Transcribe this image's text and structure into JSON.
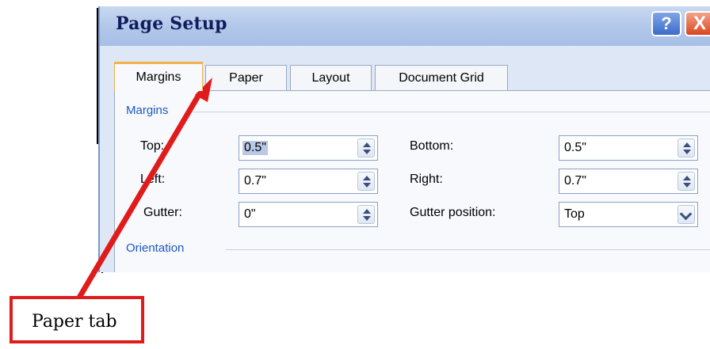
{
  "dialog": {
    "title": "Page Setup",
    "help_label": "?",
    "close_label": "X",
    "tabs": [
      {
        "label": "Margins"
      },
      {
        "label": "Paper"
      },
      {
        "label": "Layout"
      },
      {
        "label": "Document Grid"
      }
    ],
    "margins_group": "Margins",
    "fields": {
      "top": {
        "label": "Top:",
        "value": "0.5\""
      },
      "bottom": {
        "label": "Bottom:",
        "value": "0.5\""
      },
      "left": {
        "label": "Left:",
        "value": "0.7\""
      },
      "right": {
        "label": "Right:",
        "value": "0.7\""
      },
      "gutter": {
        "label": "Gutter:",
        "value": "0\""
      },
      "gutter_position": {
        "label": "Gutter position:",
        "value": "Top"
      }
    },
    "orientation_group": "Orientation"
  },
  "annotation": {
    "label": "Paper tab",
    "color": "#e01b1b"
  }
}
